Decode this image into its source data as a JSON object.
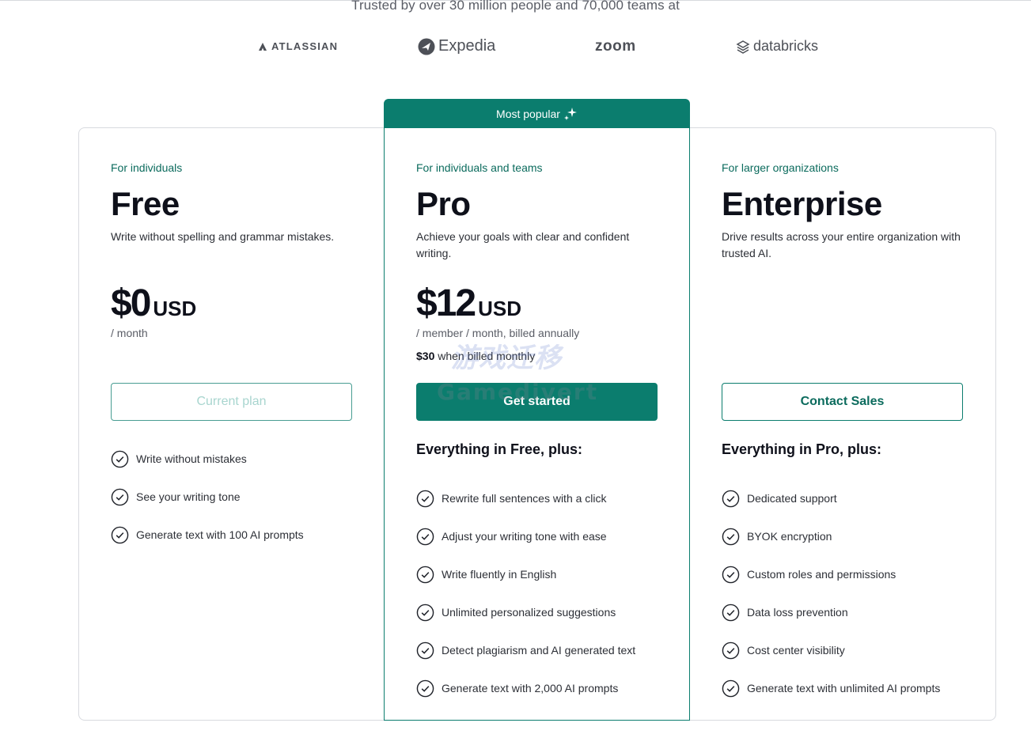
{
  "header": {
    "trusted_text": "Trusted by over 30 million people and 70,000 teams at"
  },
  "logos": [
    {
      "name": "ATLASSIAN"
    },
    {
      "name": "Expedia"
    },
    {
      "name": "zoom"
    },
    {
      "name": "databricks"
    }
  ],
  "badge": {
    "label": "Most popular",
    "icon": "sparkle-icon"
  },
  "plans": {
    "free": {
      "audience": "For individuals",
      "name": "Free",
      "description": "Write without spelling and grammar mistakes.",
      "price": "$0",
      "currency": "USD",
      "period": "/ month",
      "cta": "Current plan",
      "features": [
        "Write without mistakes",
        "See your writing tone",
        "Generate text with 100 AI prompts"
      ]
    },
    "pro": {
      "audience": "For individuals and teams",
      "name": "Pro",
      "description": "Achieve your goals with clear and confident writing.",
      "price": "$12",
      "currency": "USD",
      "period": "/ member / month, billed annually",
      "monthly_price": "$30",
      "monthly_suffix": " when billed monthly",
      "cta": "Get started",
      "features_heading": "Everything in Free, plus:",
      "features": [
        "Rewrite full sentences with a click",
        "Adjust your writing tone with ease",
        "Write fluently in English",
        "Unlimited personalized suggestions",
        "Detect plagiarism and AI generated text",
        "Generate text with 2,000 AI prompts"
      ]
    },
    "enterprise": {
      "audience": "For larger organizations",
      "name": "Enterprise",
      "description": "Drive results across your entire organization with trusted AI.",
      "cta": "Contact Sales",
      "features_heading": "Everything in Pro, plus:",
      "features": [
        "Dedicated support",
        "BYOK encryption",
        "Custom roles and permissions",
        "Data loss prevention",
        "Cost center visibility",
        "Generate text with unlimited AI prompts"
      ]
    }
  },
  "watermark": {
    "text": "Gamedivert",
    "top_text": "游戏迁移"
  },
  "colors": {
    "accent": "#0b7d6e",
    "accent_text": "#0b6b5d",
    "border": "#d8dadf"
  }
}
